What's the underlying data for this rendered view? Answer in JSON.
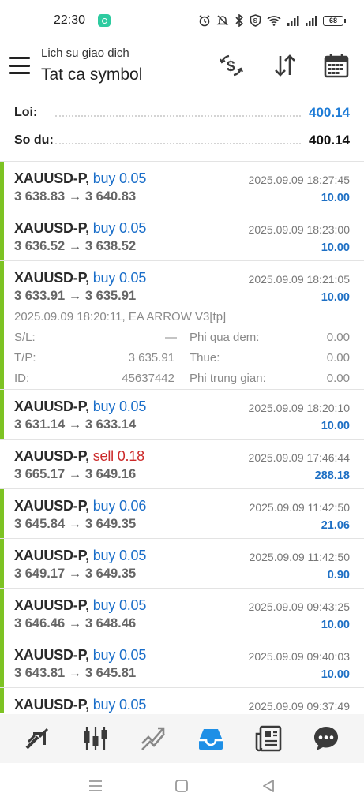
{
  "status_bar": {
    "time": "22:30",
    "battery": "68"
  },
  "header": {
    "subtitle": "Lich su giao dich",
    "title": "Tat ca symbol"
  },
  "summary": {
    "profit_label": "Loi:",
    "profit_value": "400.14",
    "balance_label": "So du:",
    "balance_value": "400.14"
  },
  "deals": [
    {
      "symbol": "XAUUSD-P,",
      "side": "buy",
      "volume": "0.05",
      "prices": "3 638.83 → 3 640.83",
      "time": "2025.09.09 18:27:45",
      "profit": "10.00"
    },
    {
      "symbol": "XAUUSD-P,",
      "side": "buy",
      "volume": "0.05",
      "prices": "3 636.52 → 3 638.52",
      "time": "2025.09.09 18:23:00",
      "profit": "10.00"
    },
    {
      "symbol": "XAUUSD-P,",
      "side": "buy",
      "volume": "0.05",
      "prices": "3 633.91 → 3 635.91",
      "time": "2025.09.09 18:21:05",
      "profit": "10.00"
    },
    {
      "symbol": "XAUUSD-P,",
      "side": "buy",
      "volume": "0.05",
      "prices": "3 631.14 → 3 633.14",
      "time": "2025.09.09 18:20:10",
      "profit": "10.00"
    },
    {
      "symbol": "XAUUSD-P,",
      "side": "sell",
      "volume": "0.18",
      "prices": "3 665.17 → 3 649.16",
      "time": "2025.09.09 17:46:44",
      "profit": "288.18"
    },
    {
      "symbol": "XAUUSD-P,",
      "side": "buy",
      "volume": "0.06",
      "prices": "3 645.84 → 3 649.35",
      "time": "2025.09.09 11:42:50",
      "profit": "21.06"
    },
    {
      "symbol": "XAUUSD-P,",
      "side": "buy",
      "volume": "0.05",
      "prices": "3 649.17 → 3 649.35",
      "time": "2025.09.09 11:42:50",
      "profit": "0.90"
    },
    {
      "symbol": "XAUUSD-P,",
      "side": "buy",
      "volume": "0.05",
      "prices": "3 646.46 → 3 648.46",
      "time": "2025.09.09 09:43:25",
      "profit": "10.00"
    },
    {
      "symbol": "XAUUSD-P,",
      "side": "buy",
      "volume": "0.05",
      "prices": "3 643.81 → 3 645.81",
      "time": "2025.09.09 09:40:03",
      "profit": "10.00"
    },
    {
      "symbol": "XAUUSD-P,",
      "side": "buy",
      "volume": "0.05",
      "prices": "",
      "time": "2025.09.09 09:37:49",
      "profit": ""
    }
  ],
  "expanded_deal": {
    "open_line": "2025.09.09 18:20:11, EA ARROW V3[tp]",
    "sl_label": "S/L:",
    "sl_value": "—",
    "tp_label": "T/P:",
    "tp_value": "3 635.91",
    "id_label": "ID:",
    "id_value": "45637442",
    "swap_label": "Phi qua dem:",
    "swap_value": "0.00",
    "tax_label": "Thue:",
    "tax_value": "0.00",
    "commission_label": "Phi trung gian:",
    "commission_value": "0.00"
  },
  "colors": {
    "buy": "#1a6ec9",
    "sell": "#cc2a2a",
    "profit": "#1d6fc4",
    "accent_bar": "#7dc323",
    "active_nav": "#1e8fe6",
    "icon": "#3a3a3a"
  },
  "icons": {
    "header": [
      "currency-exchange-icon",
      "sort-icon",
      "calendar-icon"
    ],
    "bottom_nav": [
      "quotes-icon",
      "chart-icon",
      "trade-icon",
      "history-icon",
      "news-icon",
      "chat-icon"
    ],
    "system_nav": [
      "menu-icon",
      "home-icon",
      "back-icon"
    ]
  }
}
